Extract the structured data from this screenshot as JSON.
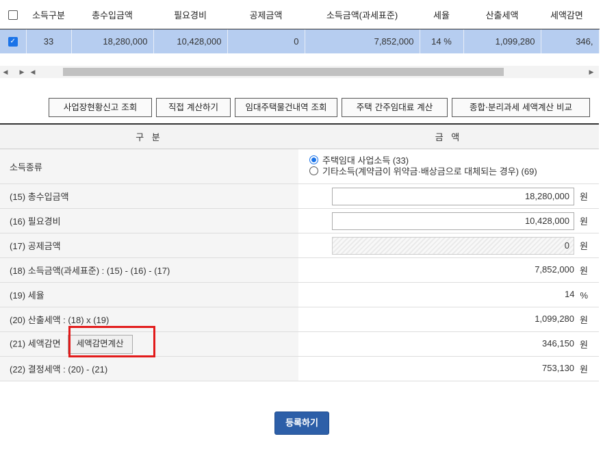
{
  "summary": {
    "headers": [
      "소득구분",
      "총수입금액",
      "필요경비",
      "공제금액",
      "소득금액(과세표준)",
      "세율",
      "산출세액",
      "세액감면"
    ],
    "row": [
      "33",
      "18,280,000",
      "10,428,000",
      "0",
      "7,852,000",
      "14 %",
      "1,099,280",
      "346,"
    ]
  },
  "scroll": {
    "left_glyphs": "◀ ▶ ◀",
    "right_glyph": "▶"
  },
  "buttons": [
    "사업장현황신고 조회",
    "직접 계산하기",
    "임대주택물건내역 조회",
    "주택 간주임대료 계산",
    "종합·분리과세 세액계산 비교"
  ],
  "detail": {
    "header_left": "구 분",
    "header_right": "금 액",
    "income_type_label": "소득종류",
    "income_options": [
      "주택임대 사업소득 (33)",
      "기타소득(계약금이 위약금·배상금으로 대체되는 경우) (69)"
    ],
    "rows": [
      {
        "label": "(15) 총수입금액",
        "value": "18,280,000",
        "unit": "원"
      },
      {
        "label": "(16) 필요경비",
        "value": "10,428,000",
        "unit": "원"
      },
      {
        "label": "(17) 공제금액",
        "value": "0",
        "unit": "원"
      },
      {
        "label": "(18) 소득금액(과세표준) : (15) - (16) - (17)",
        "value": "7,852,000",
        "unit": "원"
      },
      {
        "label": "(19) 세율",
        "value": "14",
        "unit": "%"
      },
      {
        "label": "(20) 산출세액 : (18) x (19)",
        "value": "1,099,280",
        "unit": "원"
      },
      {
        "label": "(21) 세액감면",
        "value": "346,150",
        "unit": "원",
        "button": "세액감면계산"
      },
      {
        "label": "(22) 결정세액 : (20) - (21)",
        "value": "753,130",
        "unit": "원"
      }
    ]
  },
  "submit_label": "등록하기",
  "colors": {
    "selected_row": "#b6cdf0",
    "accent": "#1a73e8",
    "highlight": "#e21a1a",
    "submit": "#2d5fa8"
  }
}
